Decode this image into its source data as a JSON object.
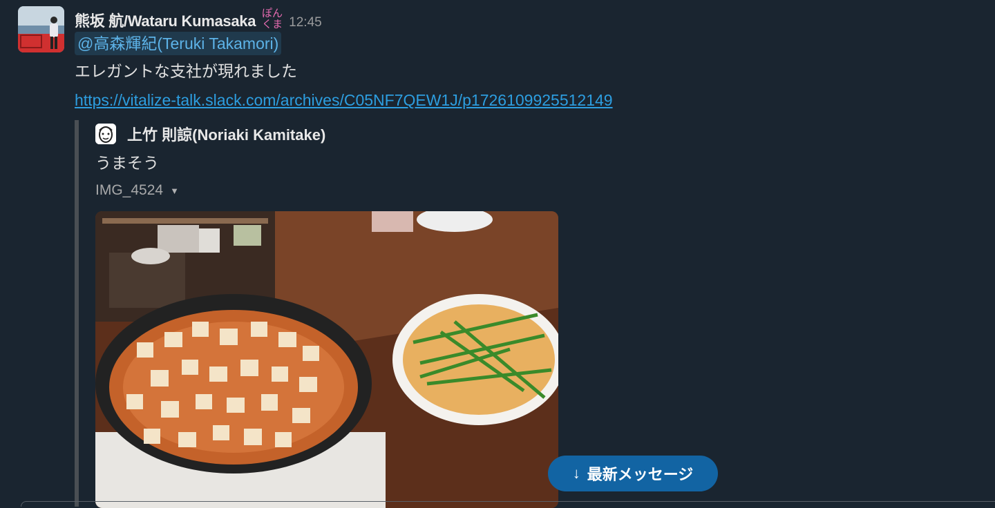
{
  "message": {
    "sender": "熊坂 航/Wataru Kumasaka",
    "status_emoji_text": "ぽんくま",
    "timestamp": "12:45",
    "mention": "@高森輝紀(Teruki Takamori)",
    "text": "エレガントな支社が現れました",
    "link": "https://vitalize-talk.slack.com/archives/C05NF7QEW1J/p1726109925512149"
  },
  "quoted": {
    "author": "上竹 則諒(Noriaki Kamitake)",
    "text": "うまそう",
    "file_name": "IMG_4524",
    "image_icon": "food-photo"
  },
  "jump_button": {
    "label": "最新メッセージ",
    "icon": "arrow-down-icon"
  },
  "colors": {
    "background": "#1a2530",
    "link": "#2d9ee0",
    "mention_bg": "#203a4d",
    "button": "#1264a3"
  }
}
